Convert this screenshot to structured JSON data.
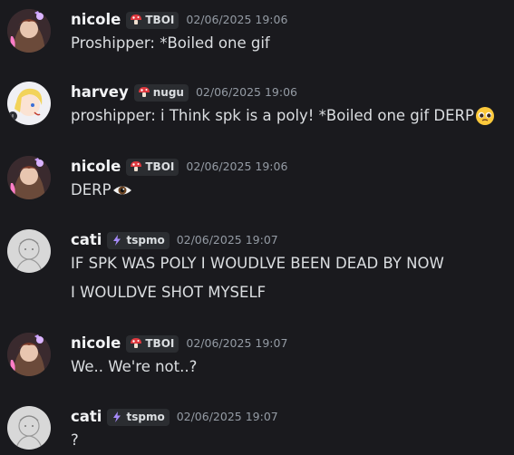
{
  "messages": [
    {
      "username": "nicole",
      "tag": "TBOI",
      "tag_icon": "mushroom-icon",
      "timestamp": "02/06/2025 19:06",
      "lines": [
        "Proshipper: *Boiled one gif"
      ]
    },
    {
      "username": "harvey",
      "tag": "nugu",
      "tag_icon": "mushroom-icon",
      "timestamp": "02/06/2025 19:06",
      "lines": [
        "proshipper: i Think spk is a poly! *Boiled one gif DERP"
      ],
      "emoji": "pleading-face-emoji"
    },
    {
      "username": "nicole",
      "tag": "TBOI",
      "tag_icon": "mushroom-icon",
      "timestamp": "02/06/2025 19:06",
      "lines": [
        "DERP"
      ],
      "emoji": "eye-emoji"
    },
    {
      "username": "cati",
      "tag": "tspmo",
      "tag_icon": "lightning-icon",
      "timestamp": "02/06/2025 19:07",
      "lines": [
        "IF SPK WAS POLY I WOUDLVE BEEN DEAD BY NOW",
        "I WOULDVE SHOT MYSELF"
      ]
    },
    {
      "username": "nicole",
      "tag": "TBOI",
      "tag_icon": "mushroom-icon",
      "timestamp": "02/06/2025 19:07",
      "lines": [
        "We.. We're not..?"
      ]
    },
    {
      "username": "cati",
      "tag": "tspmo",
      "tag_icon": "lightning-icon",
      "timestamp": "02/06/2025 19:07",
      "lines": [
        "?"
      ]
    }
  ],
  "colors": {
    "background": "#1a1a1e",
    "username": "#f2f3f5",
    "text": "#dbdee1",
    "timestamp": "#949ba4",
    "tag_bg": "#2b2d31",
    "mushroom_red": "#e0383e",
    "lightning_purple": "#a78bfa"
  }
}
